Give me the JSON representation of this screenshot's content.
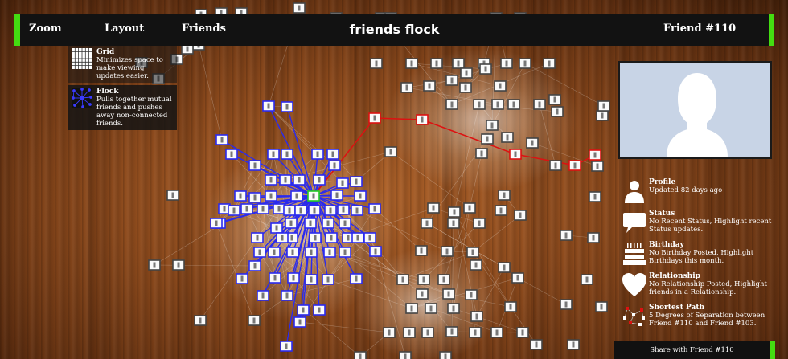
{
  "app": {
    "title": "friends flock"
  },
  "nav": {
    "zoom": "Zoom",
    "layout": "Layout",
    "friends": "Friends",
    "selected": "Friend #110"
  },
  "layout_options": [
    {
      "name": "Grid",
      "desc": "Minimizes space to make viewing updates easier."
    },
    {
      "name": "Flock",
      "desc": "Pulls together mutual friends and pushes away non-connected friends."
    }
  ],
  "info": {
    "profile": {
      "title": "Profile",
      "text": "Updated 82 days ago"
    },
    "status": {
      "title": "Status",
      "text": "No Recent Status, Highlight recent Status updates."
    },
    "birthday": {
      "title": "Birthday",
      "text": "No Birthday Posted, Highlight Birthdays this month."
    },
    "relationship": {
      "title": "Relationship",
      "text": "No Relationship Posted, Highlight friends in a Relationship."
    },
    "shortest_path": {
      "title": "Shortest Path",
      "text": "5 Degrees of Separation between Friend #110 and Friend #103."
    }
  },
  "share": {
    "label": "Share with Friend #110"
  },
  "colors": {
    "accent": "#44dd11",
    "bar": "#121212",
    "highlight_blue": "#2a2aee",
    "path_red": "#dd1111",
    "selected_node": "#22cc22",
    "photo_bg": "#c8d4e6"
  },
  "icons": {
    "grid": "grid-icon",
    "flock": "flock-icon",
    "profile": "person-icon",
    "status": "speech-bubble-icon",
    "birthday": "cake-icon",
    "relationship": "heart-icon",
    "shortest_path": "path-network-icon"
  }
}
